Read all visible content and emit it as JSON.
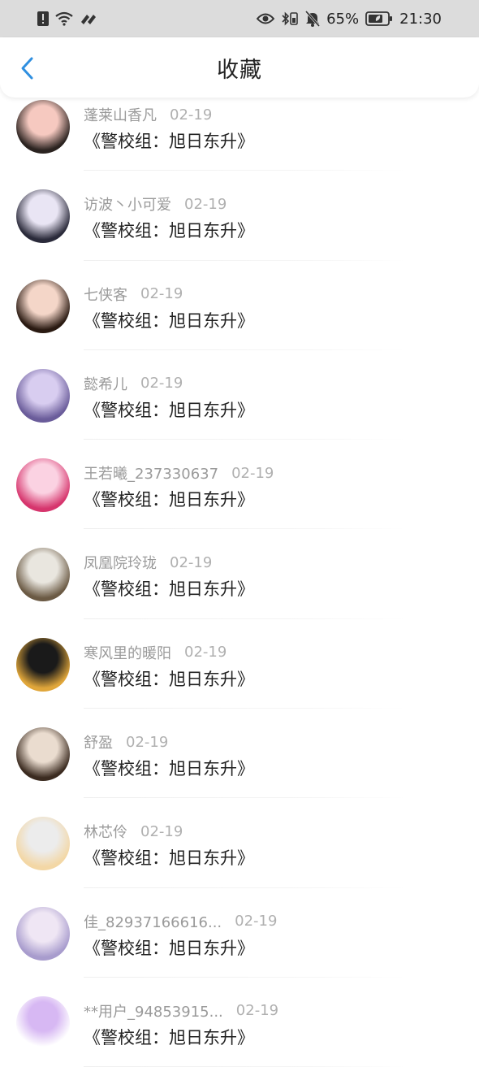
{
  "status_bar": {
    "battery": "65%",
    "time": "21:30"
  },
  "header": {
    "title": "收藏"
  },
  "items": [
    {
      "name": "蓬莱山香凡",
      "date": "02-19",
      "title": "《警校组：旭日东升》",
      "colors": [
        "#f6c9c0",
        "#2b2320"
      ]
    },
    {
      "name": "访波丶小可爱",
      "date": "02-19",
      "title": "《警校组：旭日东升》",
      "colors": [
        "#e9e5f4",
        "#2a2a3a"
      ]
    },
    {
      "name": "七侠客",
      "date": "02-19",
      "title": "《警校组：旭日东升》",
      "colors": [
        "#f4d6c8",
        "#2a1a12"
      ]
    },
    {
      "name": "懿希儿",
      "date": "02-19",
      "title": "《警校组：旭日东升》",
      "colors": [
        "#d8cdf0",
        "#6a5c9a"
      ]
    },
    {
      "name": "王若曦_237330637",
      "date": "02-19",
      "title": "《警校组：旭日东升》",
      "colors": [
        "#fbd2e2",
        "#d6356d"
      ]
    },
    {
      "name": "凤凰院玲珑",
      "date": "02-19",
      "title": "《警校组：旭日东升》",
      "colors": [
        "#e9e6df",
        "#6b5a44"
      ]
    },
    {
      "name": "寒风里的暖阳",
      "date": "02-19",
      "title": "《警校组：旭日东升》",
      "colors": [
        "#1a1a1a",
        "#e0a63a"
      ]
    },
    {
      "name": "舒盈",
      "date": "02-19",
      "title": "《警校组：旭日东升》",
      "colors": [
        "#eadccf",
        "#3b2b20"
      ]
    },
    {
      "name": "林芯伶",
      "date": "02-19",
      "title": "《警校组：旭日东升》",
      "colors": [
        "#ececec",
        "#f3d7a5"
      ]
    },
    {
      "name": "佳_82937166616...",
      "date": "02-19",
      "title": "《警校组：旭日东升》",
      "colors": [
        "#efe6f4",
        "#a89ccd"
      ]
    },
    {
      "name": "**用户_94853915...",
      "date": "02-19",
      "title": "《警校组：旭日东升》",
      "colors": [
        "#d7b8f3",
        "#ffffff"
      ]
    }
  ]
}
